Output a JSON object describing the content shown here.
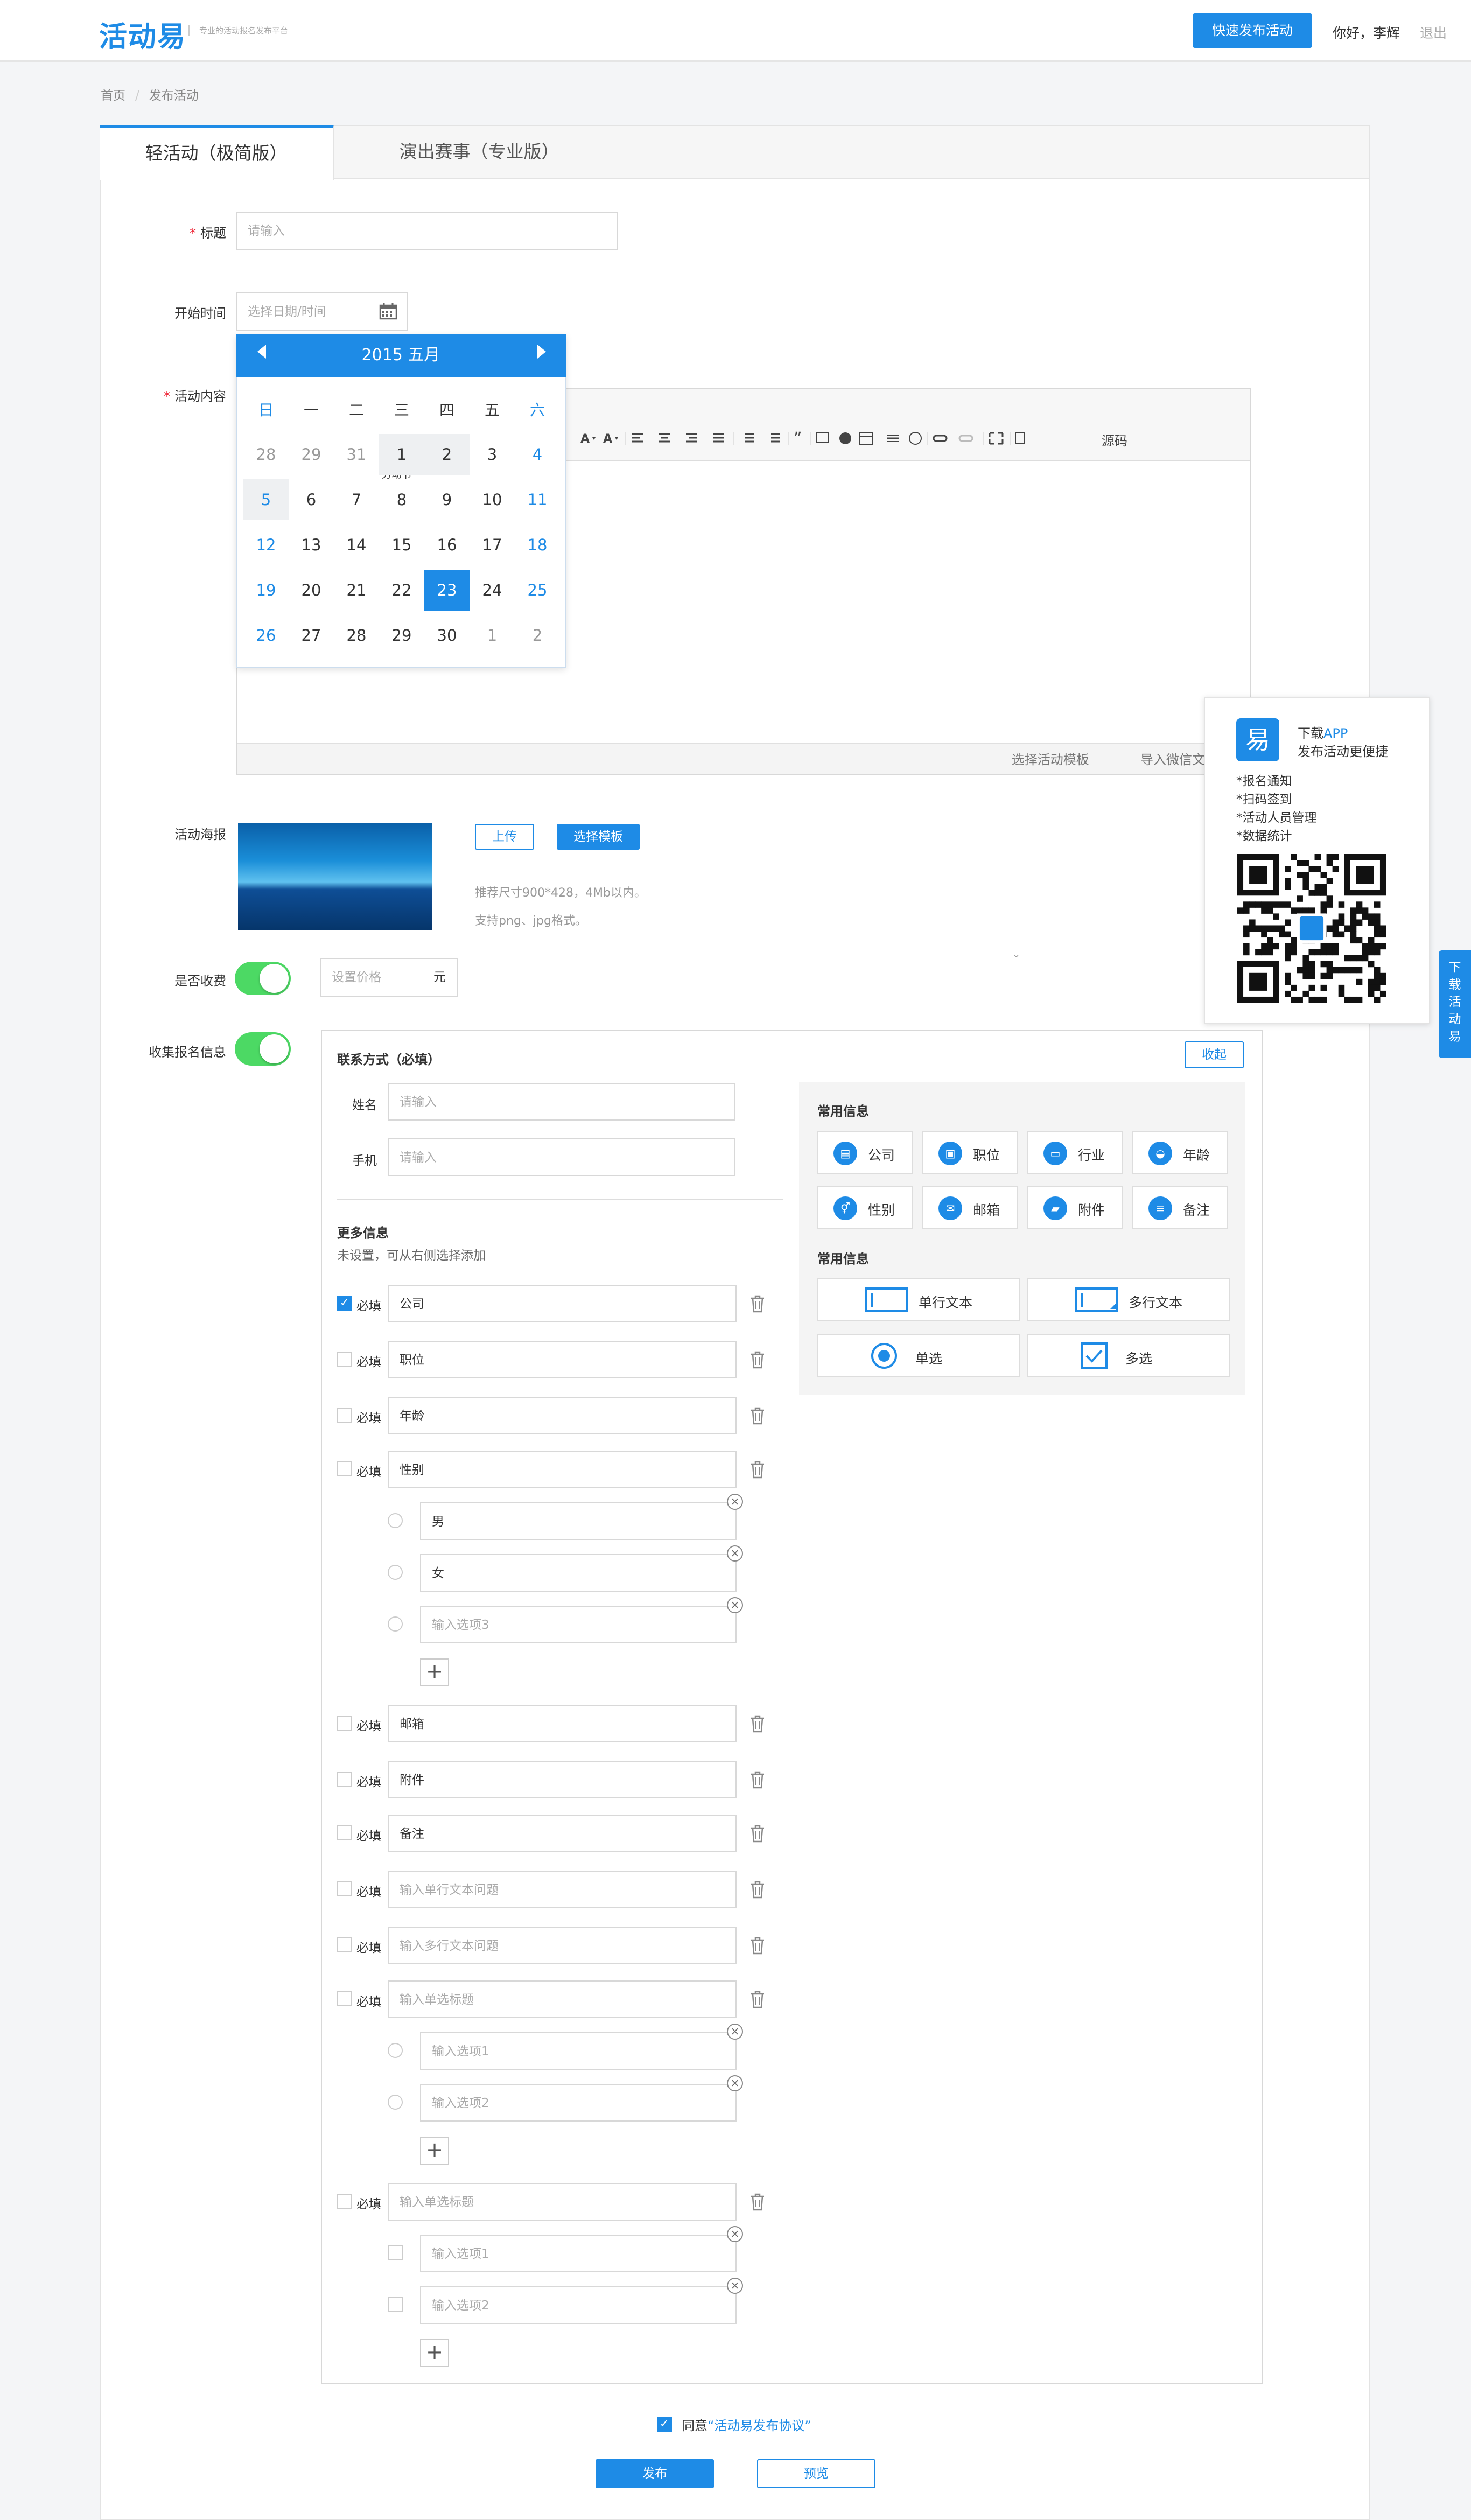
{
  "header": {
    "logo": "活动易",
    "slogan": "专业的活动报名发布平台",
    "quick_publish": "快速发布活动",
    "greeting": "你好，李辉",
    "logout": "退出"
  },
  "breadcrumb": [
    "首页",
    "发布活动"
  ],
  "tabs": [
    "轻活动（极简版）",
    "演出赛事（专业版）"
  ],
  "form": {
    "title_label": "标题",
    "title_placeholder": "请输入",
    "start_label": "开始时间",
    "start_placeholder": "选择日期/时间",
    "content_label": "活动内容",
    "poster_label": "活动海报",
    "upload": "上传",
    "choose_template": "选择模板",
    "poster_hint1": "推荐尺寸900*428，4Mb以内。",
    "poster_hint2": "支持png、jpg格式。",
    "fee_label": "是否收费",
    "price_placeholder": "设置价格",
    "price_unit": "元",
    "collect_label": "收集报名信息"
  },
  "calendar": {
    "title": "2015 五月",
    "weekdays": [
      "日",
      "一",
      "二",
      "三",
      "四",
      "五",
      "六"
    ],
    "weeks": [
      [
        "28",
        "29",
        "31",
        "1",
        "2",
        "3",
        "4"
      ],
      [
        "5",
        "6",
        "7",
        "8",
        "9",
        "10",
        "11"
      ],
      [
        "12",
        "13",
        "14",
        "15",
        "16",
        "17",
        "18"
      ],
      [
        "19",
        "20",
        "21",
        "22",
        "23",
        "24",
        "25"
      ],
      [
        "26",
        "27",
        "28",
        "29",
        "30",
        "1",
        "2"
      ]
    ],
    "festival": "劳动节",
    "selected": "23"
  },
  "editor": {
    "source_label": "源码",
    "choose_template": "选择活动模板",
    "import_wechat": "导入微信文章"
  },
  "contact": {
    "title": "联系方式（必填）",
    "collapse": "收起",
    "name_label": "姓名",
    "phone_label": "手机",
    "placeholder": "请输入"
  },
  "more": {
    "title": "更多信息",
    "desc": "未设置，可从右侧选择添加",
    "required": "必填",
    "fields": [
      "公司",
      "职位",
      "年龄",
      "性别"
    ],
    "gender_options": [
      "男",
      "女"
    ],
    "option3_placeholder": "输入选项3",
    "fields2": [
      "邮箱",
      "附件",
      "备注"
    ],
    "single_text_ph": "输入单行文本问题",
    "multi_text_ph": "输入多行文本问题",
    "radio_title_ph": "输入单选标题",
    "opt1_ph": "输入选项1",
    "opt2_ph": "输入选项2"
  },
  "common": {
    "title1": "常用信息",
    "chips": [
      "公司",
      "职位",
      "行业",
      "年龄",
      "性别",
      "邮箱",
      "附件",
      "备注"
    ],
    "title2": "常用信息",
    "wide_chips": [
      "单行文本",
      "多行文本",
      "单选",
      "多选"
    ]
  },
  "download": {
    "line1_prefix": "下载",
    "line1_app": "APP",
    "line2": "发布活动更便捷",
    "features": [
      "*报名通知",
      "*扫码签到",
      "*活动人员管理",
      "*数据统计"
    ],
    "side_tab": "下载活动易",
    "icon_char": "易"
  },
  "footer": {
    "agree_prefix": "同意",
    "agree_link": "“活动易发布协议”",
    "publish": "发布",
    "preview": "预览"
  }
}
